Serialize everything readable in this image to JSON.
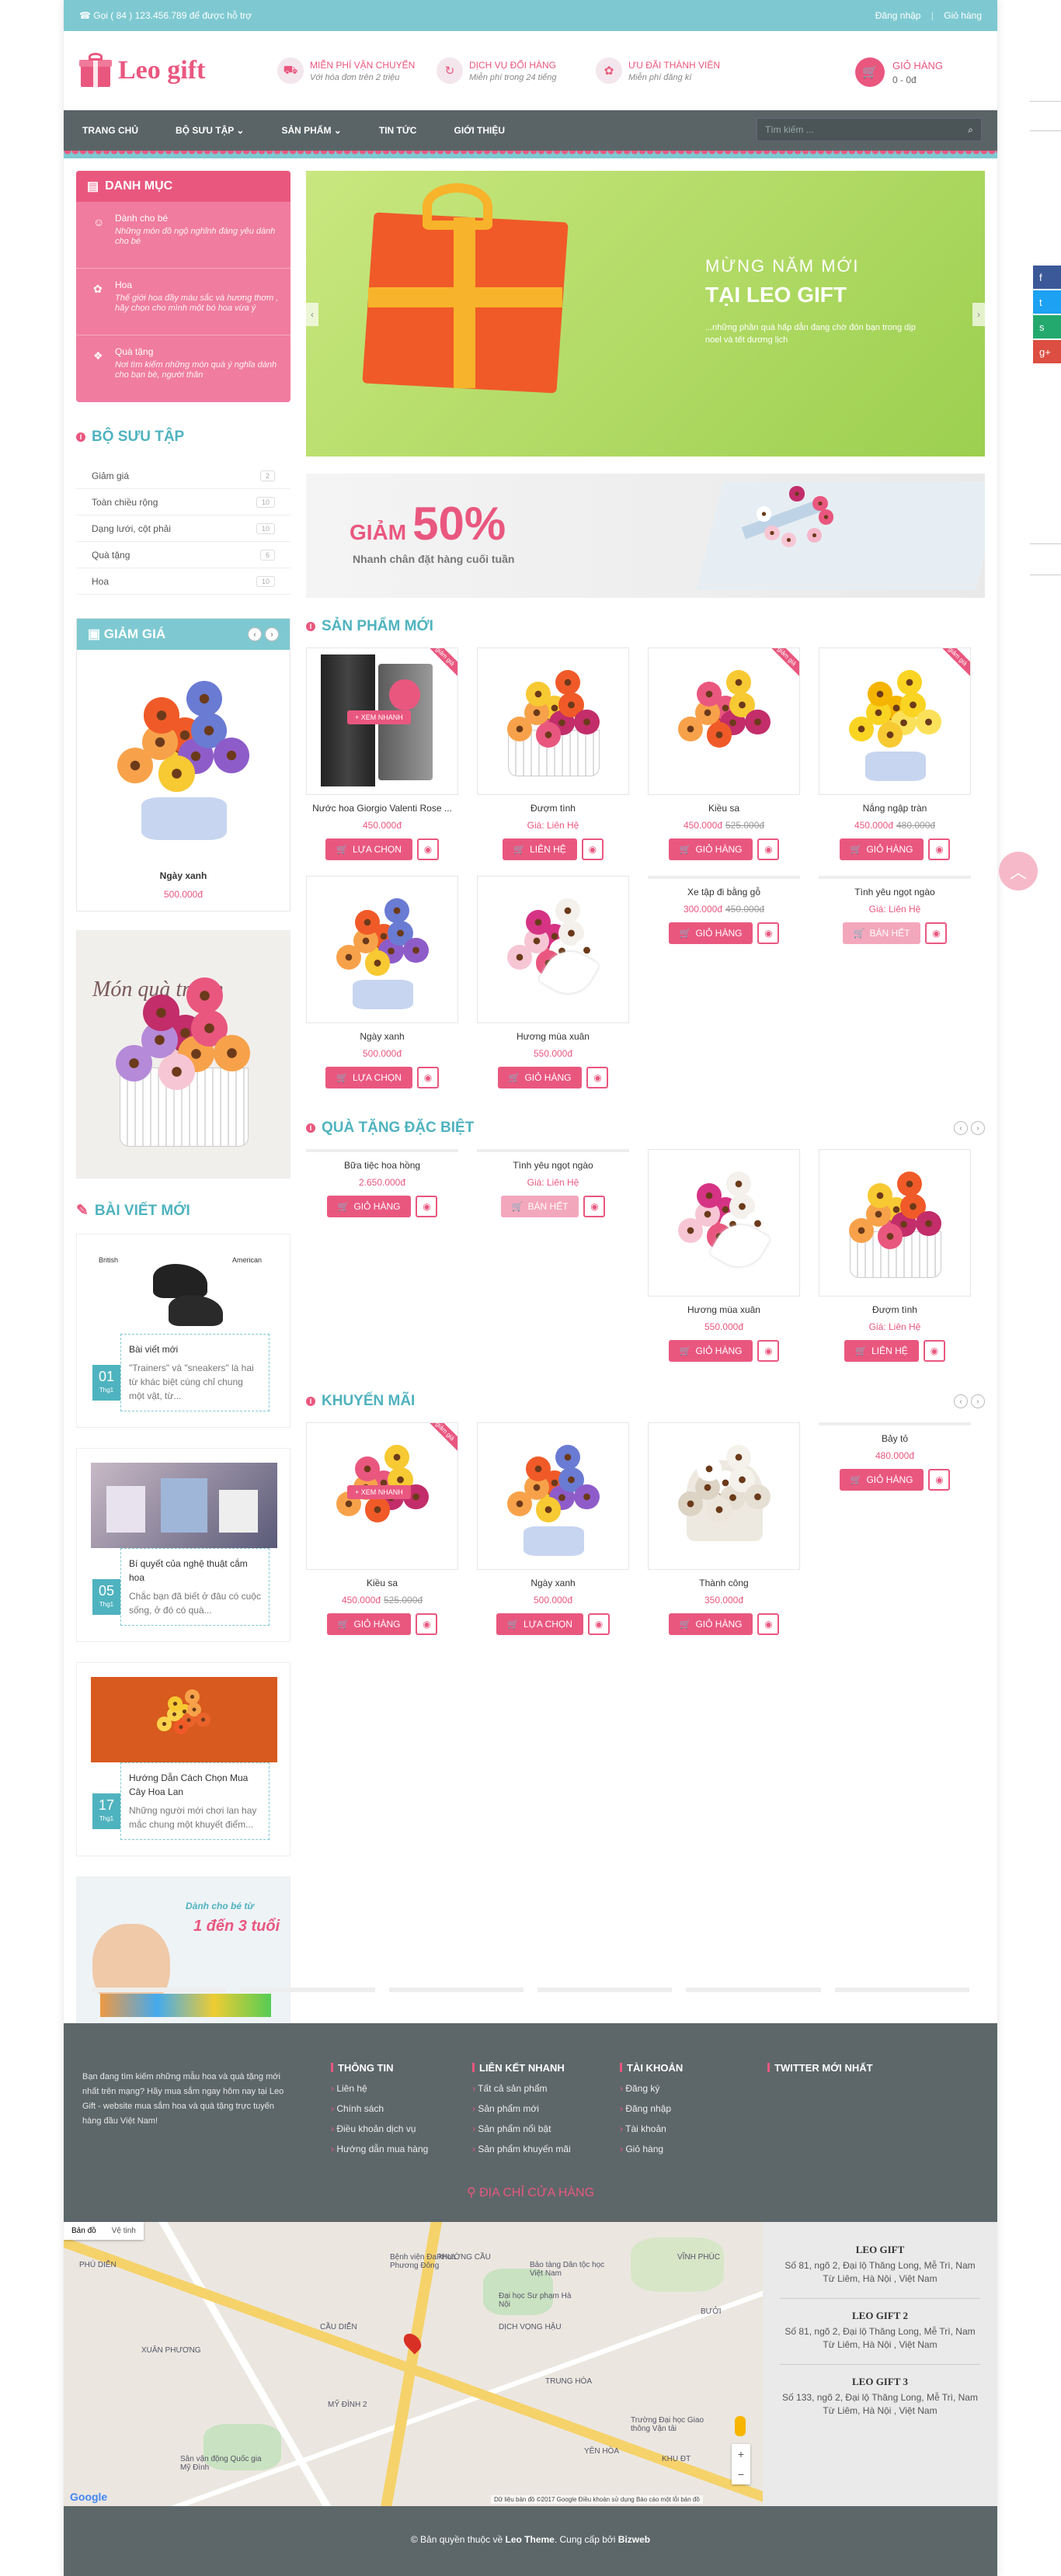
{
  "topbar": {
    "phone": "Gọi ( 84 ) 123.456.789 để được hỗ trợ",
    "login": "Đăng nhập",
    "sep": "|",
    "cart": "Giỏ hàng"
  },
  "logo": {
    "name": "Leo gift"
  },
  "features": [
    {
      "title": "MIỄN PHÍ VẬN CHUYỂN",
      "sub": "Với hóa đơn trên 2 triệu",
      "icon": "truck-icon"
    },
    {
      "title": "DỊCH VỤ ĐỔI HÀNG",
      "sub": "Miễn phí trong 24 tiếng",
      "icon": "refresh-icon"
    },
    {
      "title": "ƯU ĐÃI THÀNH VIÊN",
      "sub": "Miễn phí đăng kí",
      "icon": "gift-icon"
    }
  ],
  "cart": {
    "title": "GIỎ HÀNG",
    "value": "0 - 0đ"
  },
  "nav": {
    "items": [
      "TRANG CHỦ",
      "BỘ SƯU TẬP ⌄",
      "SẢN PHẨM ⌄",
      "TIN TỨC",
      "GIỚI THIỆU"
    ],
    "search_placeholder": "Tìm kiếm ..."
  },
  "category": {
    "title": "DANH MỤC",
    "items": [
      {
        "title": "Dành cho bé",
        "desc": "Những món đồ ngộ nghĩnh đáng yêu dành cho bé"
      },
      {
        "title": "Hoa",
        "desc": "Thế giới hoa đầy màu sắc và hương thơm , hãy chọn cho mình một bó hoa vừa ý"
      },
      {
        "title": "Quà tặng",
        "desc": "Nơi tìm kiếm những món quà ý nghĩa dành cho bạn bè, người thân"
      }
    ]
  },
  "collections": {
    "title": "BỘ SƯU TẬP",
    "items": [
      {
        "label": "Giảm giá",
        "count": "2"
      },
      {
        "label": "Toàn chiều rộng",
        "count": "10"
      },
      {
        "label": "Dạng lưới, cột phải",
        "count": "10"
      },
      {
        "label": "Quà tặng",
        "count": "6"
      },
      {
        "label": "Hoa",
        "count": "10"
      }
    ]
  },
  "sale": {
    "title": "GIẢM GIÁ",
    "product": {
      "name": "Ngày xanh",
      "price": "500.000đ"
    }
  },
  "thanks_banner": "Món quà tri ân",
  "blog": {
    "title": "BÀI VIẾT MỚI",
    "posts": [
      {
        "day": "01",
        "month": "Thg1",
        "title": "Bài viết mới",
        "excerpt": "\"Trainers\" và \"sneakers\" là hai từ khác biệt cùng chỉ chung một vật, từ...",
        "img_labels": [
          "British",
          "American"
        ]
      },
      {
        "day": "05",
        "month": "Thg1",
        "title": "Bí quyết của nghệ thuật cắm hoa",
        "excerpt": "Chắc bạn đã biết ở đâu có cuộc sống, ở đó có quà..."
      },
      {
        "day": "17",
        "month": "Thg1",
        "title": "Hướng Dẫn Cách Chọn Mua Cây Hoa Lan",
        "excerpt": "Những người mới chơi lan hay mắc chung một khuyết điểm..."
      }
    ]
  },
  "kids_banner": {
    "line1": "Dành cho bé từ",
    "line2": "1 đến 3 tuổi"
  },
  "slider": {
    "line1": "MỪNG NĂM MỚI",
    "line2": "TẠI LEO GIFT",
    "line3": "...những phần quà hấp dẫn đang chờ đón bạn trong dịp noel và tết dương lịch"
  },
  "promo": {
    "line1": "GIẢM",
    "pct": "50%",
    "line2": "Nhanh chân đặt hàng cuối tuần"
  },
  "new_products": {
    "title": "SẢN PHẨM MỚI",
    "items": [
      {
        "name": "Nước hoa Giorgio Valenti Rose ...",
        "price": "450.000đ",
        "old": "",
        "btn": "LỰA CHỌN",
        "tag": "giảm giá",
        "kind": "perfume",
        "quick": "+ XEM NHANH"
      },
      {
        "name": "Đượm tình",
        "price": "Giá: Liên Hệ",
        "old": "",
        "btn": "LIÊN HỆ",
        "tag": "",
        "kind": "basket"
      },
      {
        "name": "Kiều sa",
        "price": "450.000đ",
        "old": "525.000đ",
        "btn": "GIỎ HÀNG",
        "tag": "giảm giá",
        "kind": "bouquet"
      },
      {
        "name": "Nắng ngập tràn",
        "price": "450.000đ",
        "old": "480.000đ",
        "btn": "GIỎ HÀNG",
        "tag": "giảm giá",
        "kind": "yellow"
      },
      {
        "name": "Ngày xanh",
        "price": "500.000đ",
        "old": "",
        "btn": "LỰA CHỌN",
        "tag": "",
        "kind": "blue"
      },
      {
        "name": "Hương mùa xuân",
        "price": "550.000đ",
        "old": "",
        "btn": "GIỎ HÀNG",
        "tag": "",
        "kind": "lily"
      },
      {
        "name": "Xe tập đi bằng gỗ",
        "price": "300.000đ",
        "old": "450.000đ",
        "btn": "GIỎ HÀNG",
        "tag": "",
        "kind": "none"
      },
      {
        "name": "Tình yêu ngọt ngào",
        "price": "Giá: Liên Hệ",
        "old": "",
        "btn": "BÁN HẾT",
        "tag": "",
        "kind": "none",
        "sold": true
      }
    ]
  },
  "special": {
    "title": "QUÀ TẶNG ĐẶC BIỆT",
    "items": [
      {
        "name": "Bữa tiệc hoa hồng",
        "price": "2.650.000đ",
        "old": "",
        "btn": "GIỎ HÀNG",
        "kind": "none"
      },
      {
        "name": "Tình yêu ngọt ngào",
        "price": "Giá: Liên Hệ",
        "old": "",
        "btn": "BÁN HẾT",
        "kind": "none",
        "sold": true
      },
      {
        "name": "Hương mùa xuân",
        "price": "550.000đ",
        "old": "",
        "btn": "GIỎ HÀNG",
        "kind": "lily"
      },
      {
        "name": "Đượm tình",
        "price": "Giá: Liên Hệ",
        "old": "",
        "btn": "LIÊN HỆ",
        "kind": "basket"
      }
    ]
  },
  "promo_products": {
    "title": "KHUYẾN MÃI",
    "items": [
      {
        "name": "Kiều sa",
        "price": "450.000đ",
        "old": "525.000đ",
        "btn": "GIỎ HÀNG",
        "kind": "bouquet",
        "tag": "giảm giá",
        "quick": "+ XEM NHANH"
      },
      {
        "name": "Ngày xanh",
        "price": "500.000đ",
        "old": "",
        "btn": "LỰA CHỌN",
        "kind": "blue"
      },
      {
        "name": "Thành công",
        "price": "350.000đ",
        "old": "",
        "btn": "GIỎ HÀNG",
        "kind": "white"
      },
      {
        "name": "Bảy tỏ",
        "price": "480.000đ",
        "old": "",
        "btn": "GIỎ HÀNG",
        "kind": "none"
      }
    ]
  },
  "footer": {
    "about": "Bạn đang tìm kiếm những mẫu hoa và quà tặng mới nhất trên mạng? Hãy mua sắm ngay hôm nay tại Leo Gift - website mua sắm hoa và quà tặng trực tuyến hàng đầu Việt Nam!",
    "cols": [
      {
        "title": "THÔNG TIN",
        "items": [
          "Liên hệ",
          "Chính sách",
          "Điều khoản dịch vụ",
          "Hướng dẫn mua hàng"
        ]
      },
      {
        "title": "LIÊN KẾT NHANH",
        "items": [
          "Tất cả sản phẩm",
          "Sản phẩm mới",
          "Sản phẩm nổi bật",
          "Sản phẩm khuyến mãi"
        ]
      },
      {
        "title": "TÀI KHOẢN",
        "items": [
          "Đăng ký",
          "Đăng nhập",
          "Tài khoản",
          "Giỏ hàng"
        ]
      },
      {
        "title": "TWITTER MỚI NHẤT",
        "items": []
      }
    ]
  },
  "address_title": "ĐỊA CHỈ CỬA HÀNG",
  "map": {
    "tab1": "Bản đồ",
    "tab2": "Vệ tinh",
    "labels": [
      "PHÚ DIỄN",
      "XUÂN PHƯƠNG",
      "CẦU DIỄN",
      "PHƯỜNG CẦU",
      "MỸ ĐÌNH 2",
      "DỊCH VỌNG HẬU",
      "TRUNG HÒA",
      "YÊN HÒA",
      "VĨNH PHÚC",
      "BƯỞI",
      "Bảo tàng Dân tộc học Việt Nam",
      "Bệnh viện Đa khoa Phương Đông",
      "Đại học Sư phạm Hà Nội",
      "Sân vận động Quốc gia Mỹ Đình",
      "Trường Đại học Giao thông Vận tải",
      "KHU ĐT"
    ],
    "google": "Google",
    "credit": "Dữ liệu bản đồ ©2017 Google   Điều khoản sử dụng   Báo cáo một lỗi bản đồ"
  },
  "stores": [
    {
      "name": "LEO GIFT",
      "addr": "Số 81, ngõ 2, Đại lộ Thăng Long, Mễ Trì, Nam Từ Liêm, Hà Nội , Việt Nam"
    },
    {
      "name": "LEO GIFT 2",
      "addr": "Số 81, ngõ 2, Đại lộ Thăng Long, Mễ Trì, Nam Từ Liêm, Hà Nội , Việt Nam"
    },
    {
      "name": "LEO GIFT 3",
      "addr": "Số 133, ngõ 2, Đại lộ Thăng Long, Mễ Trì, Nam Từ Liêm, Hà Nội , Việt Nam"
    }
  ],
  "copyright": {
    "pre": "© Bản quyền thuộc về",
    "brand": "Leo Theme",
    "mid": ". Cung cấp bởi",
    "provider": "Bizweb"
  },
  "social": [
    {
      "icon": "facebook-icon",
      "glyph": "f",
      "color": "#3b5998"
    },
    {
      "icon": "twitter-icon",
      "glyph": "t",
      "color": "#1da1f2"
    },
    {
      "icon": "share-icon",
      "glyph": "s",
      "color": "#23a96d"
    },
    {
      "icon": "google-plus-icon",
      "glyph": "g+",
      "color": "#dc4e41"
    }
  ],
  "colors": {
    "pink": "#e9577f",
    "teal": "#7ec9d1",
    "dark": "#5d6769"
  }
}
